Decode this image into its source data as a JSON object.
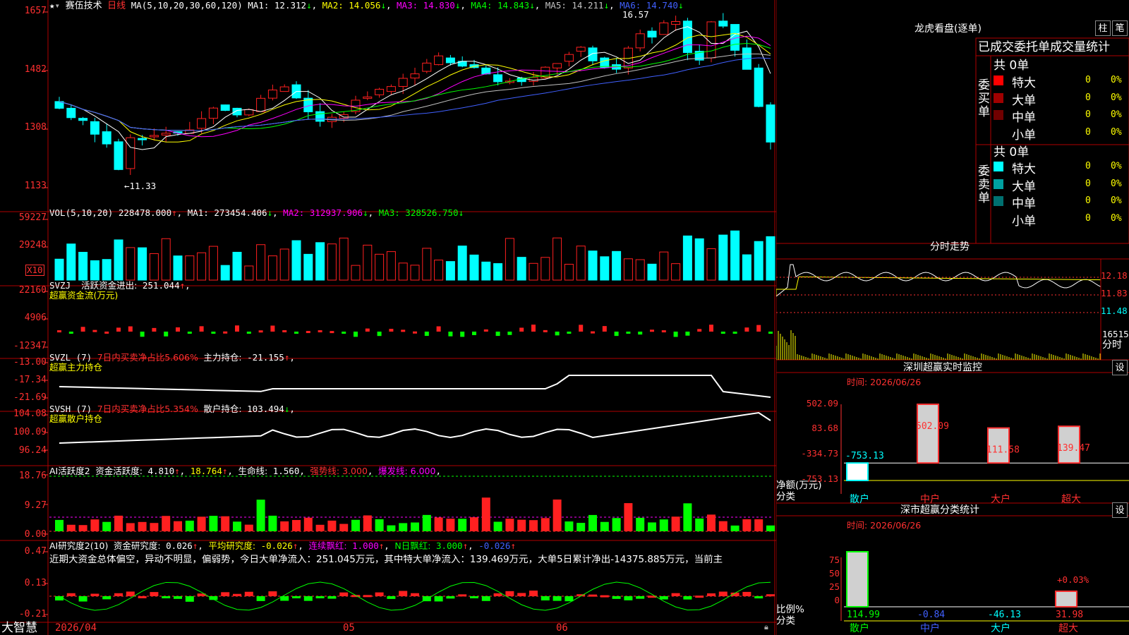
{
  "stock": {
    "name": "赛伍技术",
    "period": "日线",
    "ma_title": "MA(5,10,20,30,60,120)",
    "ma": [
      {
        "label": "MA1:",
        "value": "12.312",
        "color": "#ffffff"
      },
      {
        "label": "MA2:",
        "value": "14.056",
        "color": "#ffff00"
      },
      {
        "label": "MA3:",
        "value": "14.830",
        "color": "#ff00ff"
      },
      {
        "label": "MA4:",
        "value": "14.843",
        "color": "#00ff00"
      },
      {
        "label": "MA5:",
        "value": "14.211",
        "color": "#c0c0c0"
      },
      {
        "label": "MA6:",
        "value": "14.740",
        "color": "#4060ff"
      }
    ]
  },
  "price_axis": [
    "1657",
    "1482",
    "1308",
    "1133"
  ],
  "price_marks": {
    "high": "16.57",
    "low": "←11.33"
  },
  "vol": {
    "title": "VOL(5,10,20)",
    "value": "228478.000",
    "ma": [
      {
        "label": "MA1:",
        "value": "273454.406",
        "color": "#ffffff"
      },
      {
        "label": "MA2:",
        "value": "312937.906",
        "color": "#ff00ff"
      },
      {
        "label": "MA3:",
        "value": "328526.750",
        "color": "#00ff00"
      }
    ],
    "axis": [
      "59227",
      "29248"
    ],
    "unit": "X10"
  },
  "svzj": {
    "title": "SVZJ",
    "label": "活跃资金进出:",
    "value": "251.044",
    "sub": "超赢资金流(万元)",
    "axis": [
      "22160",
      "4906",
      "-12347"
    ]
  },
  "svzl": {
    "title": "SVZL (7)",
    "pct": "7日内买卖净占比5.606%",
    "label": "主力持仓:",
    "value": "-21.155",
    "sub": "超赢主力持仓",
    "axis": [
      "-13.00",
      "-17.34",
      "-21.69"
    ]
  },
  "svsh": {
    "title": "SVSH (7)",
    "pct": "7日内买卖净占比5.354%",
    "label": "散户持仓:",
    "value": "103.494",
    "sub": "超赢散户持仓",
    "axis": [
      "104.08",
      "100.09",
      "96.24"
    ]
  },
  "ai1": {
    "title": "AI活跃度2",
    "label": "资金活跃度:",
    "value": "4.810",
    "v2": "18.764",
    "life_label": "生命线:",
    "life": "1.560",
    "strong": "强势线: 3.000",
    "burst": "爆发线: 6.000",
    "axis": [
      "18.76",
      "9.27",
      "0.00"
    ]
  },
  "ai2": {
    "title": "AI研究度2(10)",
    "label": "资金研究度:",
    "value": "0.026",
    "avg_label": "平均研究度:",
    "avg": "-0.026",
    "red_label": "连续飘红:",
    "red": "1.000",
    "nred_label": "N日飘红:",
    "nred": "3.000",
    "last": "-0.026",
    "commentary": "近期大资金总体偏空，异动不明显，偏弱势，今日大单净流入：251.045万元，其中特大单净流入：139.469万元，大单5日累计净出-14375.885万元，当前主",
    "axis": [
      "0.47",
      "0.13",
      "-0.21"
    ]
  },
  "xaxis": {
    "d1": "2026/04",
    "d2": "05",
    "d3": "06",
    "brand": "大智慧"
  },
  "lhb": {
    "title": "龙虎看盘(逐单)",
    "btn1": "柱",
    "btn2": "笔",
    "header": "已成交委托单成交量统计",
    "buy": {
      "side": "委买单",
      "total": "共 0单",
      "rows": [
        {
          "name": "特大",
          "v": "0",
          "p": "0%",
          "color": "#ff0000"
        },
        {
          "name": "大单",
          "v": "0",
          "p": "0%",
          "color": "#a00000"
        },
        {
          "name": "中单",
          "v": "0",
          "p": "0%",
          "color": "#700000"
        },
        {
          "name": "小单",
          "v": "0",
          "p": "0%",
          "color": ""
        }
      ]
    },
    "sell": {
      "side": "委卖单",
      "total": "共 0单",
      "rows": [
        {
          "name": "特大",
          "v": "0",
          "p": "0%",
          "color": "#00ffff"
        },
        {
          "name": "大单",
          "v": "0",
          "p": "0%",
          "color": "#00a0a0"
        },
        {
          "name": "中单",
          "v": "0",
          "p": "0%",
          "color": "#007070"
        },
        {
          "name": "小单",
          "v": "0",
          "p": "0%",
          "color": ""
        }
      ]
    }
  },
  "intraday": {
    "title": "分时走势",
    "axis": [
      "12.18",
      "11.83",
      "11.48"
    ],
    "vol": "16515",
    "lbl": "分时"
  },
  "sz": {
    "title": "深圳超赢实时监控",
    "btn": "设",
    "time": "时间: 2026/06/26",
    "axis": [
      "502.09",
      "83.68",
      "-334.73",
      "-753.13"
    ],
    "ylab1": "净额(万元)",
    "ylab2": "分类",
    "cats": [
      "散户",
      "中户",
      "大户",
      "超大"
    ],
    "values": [
      -753.13,
      502.09,
      111.58,
      139.47
    ],
    "labels": [
      "-753.13",
      "502.09",
      "111.58",
      "139.47"
    ]
  },
  "ss": {
    "title": "深市超赢分类统计",
    "btn": "设",
    "time": "时间: 2026/06/26",
    "axis": [
      "75",
      "50",
      "25",
      "0"
    ],
    "ylab1": "比例%",
    "ylab2": "分类",
    "cats": [
      "散户",
      "中户",
      "大户",
      "超大"
    ],
    "values": [
      "114.99",
      "-0.84",
      "-46.13",
      "31.98"
    ],
    "extra": "+0.03%"
  },
  "colors": {
    "up": "#ff2020",
    "down": "#00ffff",
    "grid": "#b00000"
  }
}
